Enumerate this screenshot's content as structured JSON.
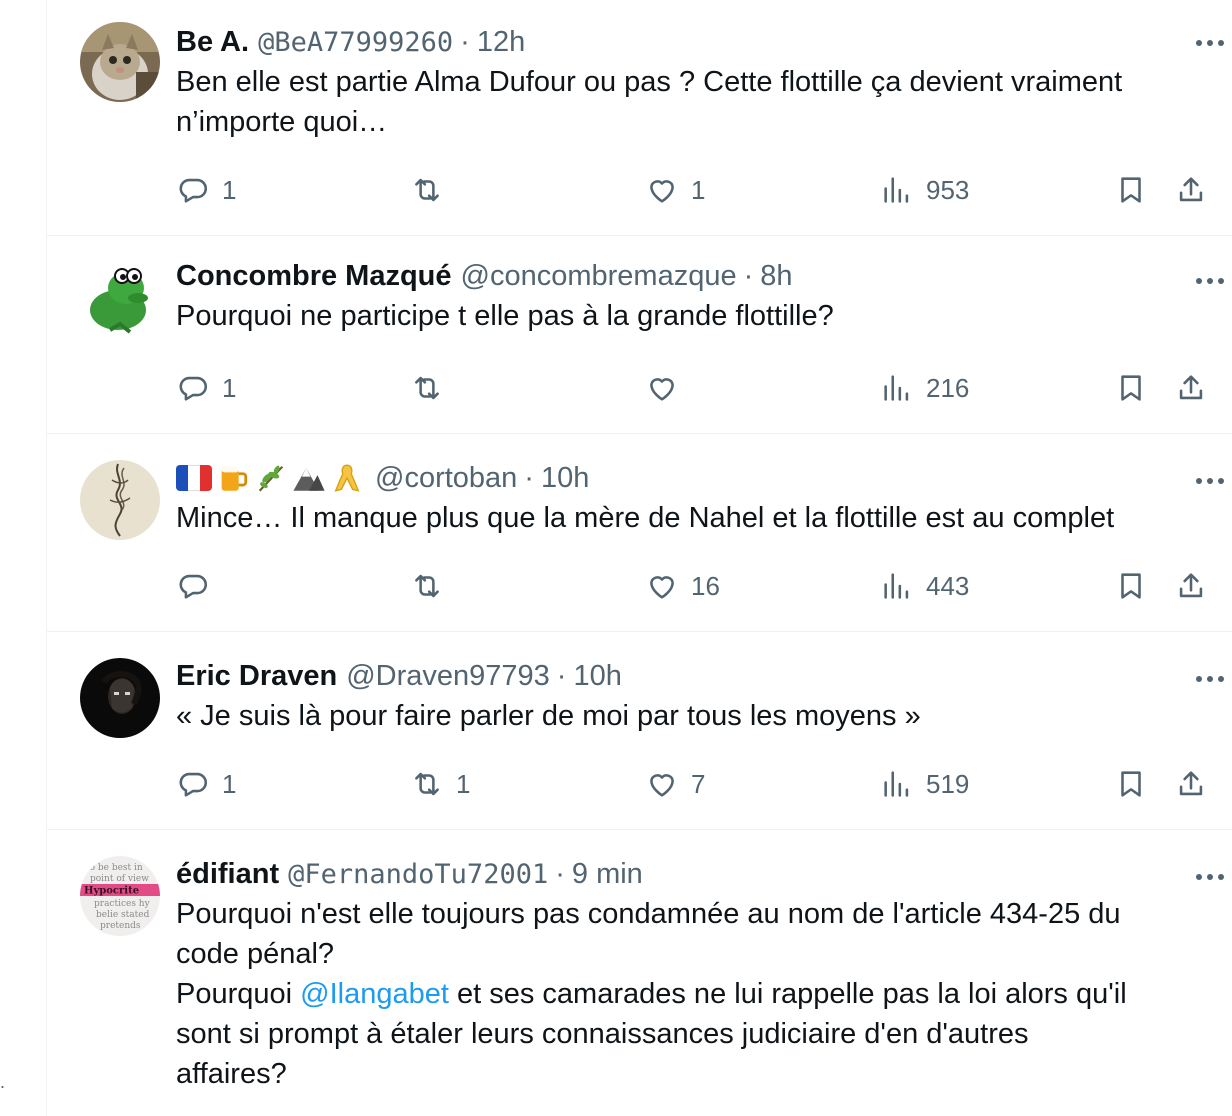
{
  "tweets": [
    {
      "name": "Be A.",
      "handle": "@BeA77999260",
      "sep": "·",
      "time": "12h",
      "text_lines": [
        "Ben elle est partie Alma Dufour ou pas ? Cette flottille ça devient vraiment",
        "n’importe quoi…"
      ],
      "reply_count": "1",
      "retweet_count": "",
      "like_count": "1",
      "view_count": "953"
    },
    {
      "name": "Concombre Mazqué",
      "handle": "@concombremazque",
      "sep": "·",
      "time": "8h",
      "text_lines": [
        "Pourquoi ne participe t elle pas à la grande flottille?"
      ],
      "reply_count": "1",
      "retweet_count": "",
      "like_count": "",
      "view_count": "216"
    },
    {
      "name_emojis": [
        "flag-france-icon",
        "beer-mug-icon",
        "herb-sprig-icon",
        "mountain-icon",
        "yellow-ribbon-icon"
      ],
      "handle": "@cortoban",
      "sep": "·",
      "time": "10h",
      "text_lines": [
        "Mince… Il manque plus que la mère de Nahel et la flottille est au complet"
      ],
      "reply_count": "",
      "retweet_count": "",
      "like_count": "16",
      "view_count": "443"
    },
    {
      "name": "Eric Draven",
      "handle": "@Draven97793",
      "sep": "·",
      "time": "10h",
      "text_lines": [
        "« Je suis là pour faire parler de moi par tous les moyens »"
      ],
      "reply_count": "1",
      "retweet_count": "1",
      "like_count": "7",
      "view_count": "519"
    },
    {
      "name": "édifiant",
      "handle": "@FernandoTu72001",
      "sep": "·",
      "time": "9 min",
      "text_lines": [
        "Pourquoi n'est elle toujours pas condamnée au nom de l'article 434-25 du",
        "code pénal?"
      ],
      "text_prefix": "Pourquoi ",
      "mention": "@Ilangabet",
      "text_suffix": " et ses camarades ne lui rappelle pas la loi alors qu'il",
      "text_lines_after": [
        "sont si prompt à étaler leurs connaissances judiciaire d'en d'autres",
        "affaires?"
      ]
    }
  ],
  "avatar_texts": [
    "to be best in",
    "point of view",
    "Hypocrite",
    "practices hy",
    "belie stated",
    "pretends"
  ],
  "colors": {
    "text_primary": "#0f1419",
    "text_secondary": "#536471",
    "mention_blue": "#1d9bf0",
    "divider": "#eff3f4"
  }
}
